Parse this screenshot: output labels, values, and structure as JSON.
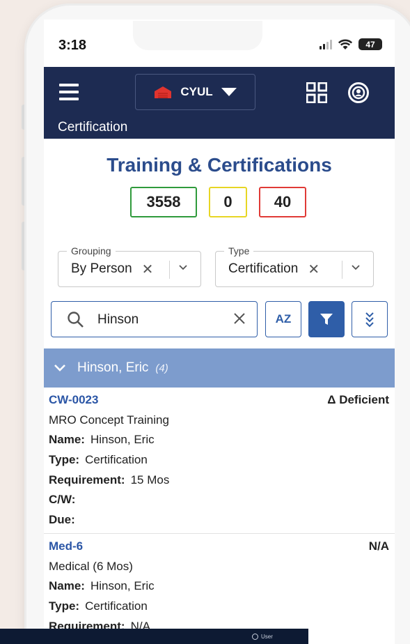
{
  "status_bar": {
    "time": "3:18",
    "battery": "47"
  },
  "app_bar": {
    "station": "CYUL",
    "section_title": "Certification"
  },
  "page": {
    "title": "Training & Certifications"
  },
  "counts": {
    "green": "3558",
    "yellow": "0",
    "red": "40"
  },
  "filters": {
    "grouping": {
      "label": "Grouping",
      "value": "By Person"
    },
    "type": {
      "label": "Type",
      "value": "Certification"
    }
  },
  "search": {
    "value": "Hinson",
    "sort_label": "AZ"
  },
  "group": {
    "name": "Hinson, Eric",
    "count": "(4)"
  },
  "labels": {
    "name": "Name:",
    "type": "Type:",
    "requirement": "Requirement:",
    "cw": "C/W:",
    "due": "Due:"
  },
  "records": [
    {
      "code": "CW-0023",
      "status": "Δ Deficient",
      "title": "MRO Concept Training",
      "name": "Hinson, Eric",
      "type": "Certification",
      "requirement": "15 Mos",
      "cw": "",
      "due": ""
    },
    {
      "code": "Med-6",
      "status": "N/A",
      "title": "Medical (6 Mos)",
      "name": "Hinson, Eric",
      "type": "Certification",
      "requirement": "N/A"
    }
  ],
  "overlay": {
    "user_label": "User"
  },
  "colors": {
    "app_bar": "#1d2b52",
    "accent": "#2f5ea8",
    "title": "#2b4c8c",
    "group_header": "#7d9ccd",
    "green": "#2f9a3b",
    "yellow": "#e7d624",
    "red": "#e03a36",
    "station_icon": "#e0342f"
  },
  "icons": [
    "menu-icon",
    "hangar-icon",
    "qr-grid-icon",
    "user-circle-icon",
    "search-icon",
    "filter-icon",
    "expand-all-icon",
    "chevron-down-icon",
    "clear-icon"
  ]
}
